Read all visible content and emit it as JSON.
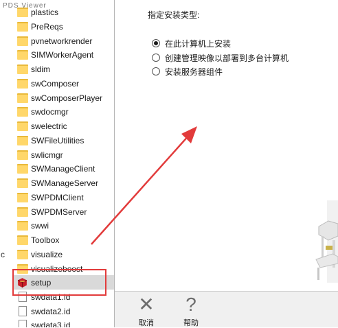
{
  "file_list": {
    "truncated_top": "PDS Viewer",
    "items": [
      {
        "label": "plastics",
        "type": "folder"
      },
      {
        "label": "PreReqs",
        "type": "folder"
      },
      {
        "label": "pvnetworkrender",
        "type": "folder"
      },
      {
        "label": "SIMWorkerAgent",
        "type": "folder"
      },
      {
        "label": "sldim",
        "type": "folder"
      },
      {
        "label": "swComposer",
        "type": "folder"
      },
      {
        "label": "swComposerPlayer",
        "type": "folder"
      },
      {
        "label": "swdocmgr",
        "type": "folder"
      },
      {
        "label": "swelectric",
        "type": "folder"
      },
      {
        "label": "SWFileUtilities",
        "type": "folder"
      },
      {
        "label": "swlicmgr",
        "type": "folder"
      },
      {
        "label": "SWManageClient",
        "type": "folder"
      },
      {
        "label": "SWManageServer",
        "type": "folder"
      },
      {
        "label": "SWPDMClient",
        "type": "folder"
      },
      {
        "label": "SWPDMServer",
        "type": "folder"
      },
      {
        "label": "swwi",
        "type": "folder"
      },
      {
        "label": "Toolbox",
        "type": "folder"
      },
      {
        "label": "visualize",
        "type": "folder"
      },
      {
        "label": "visualizeboost",
        "type": "folder"
      },
      {
        "label": "setup",
        "type": "app",
        "selected": true
      },
      {
        "label": "swdata1.id",
        "type": "file"
      },
      {
        "label": "swdata2.id",
        "type": "file"
      },
      {
        "label": "swdata3.id",
        "type": "file"
      }
    ],
    "edge_letter": "c"
  },
  "installer": {
    "install_type_label": "指定安装类型:",
    "options": [
      {
        "label": "在此计算机上安装",
        "selected": true
      },
      {
        "label": "创建管理映像以部署到多台计算机",
        "selected": false
      },
      {
        "label": "安装服务器组件",
        "selected": false
      }
    ],
    "cancel_label": "取消",
    "help_label": "帮助",
    "cancel_glyph": "✕",
    "help_glyph": "?"
  },
  "annotation": {
    "highlight_color": "#e23b3b",
    "arrow_color": "#e23b3b"
  }
}
